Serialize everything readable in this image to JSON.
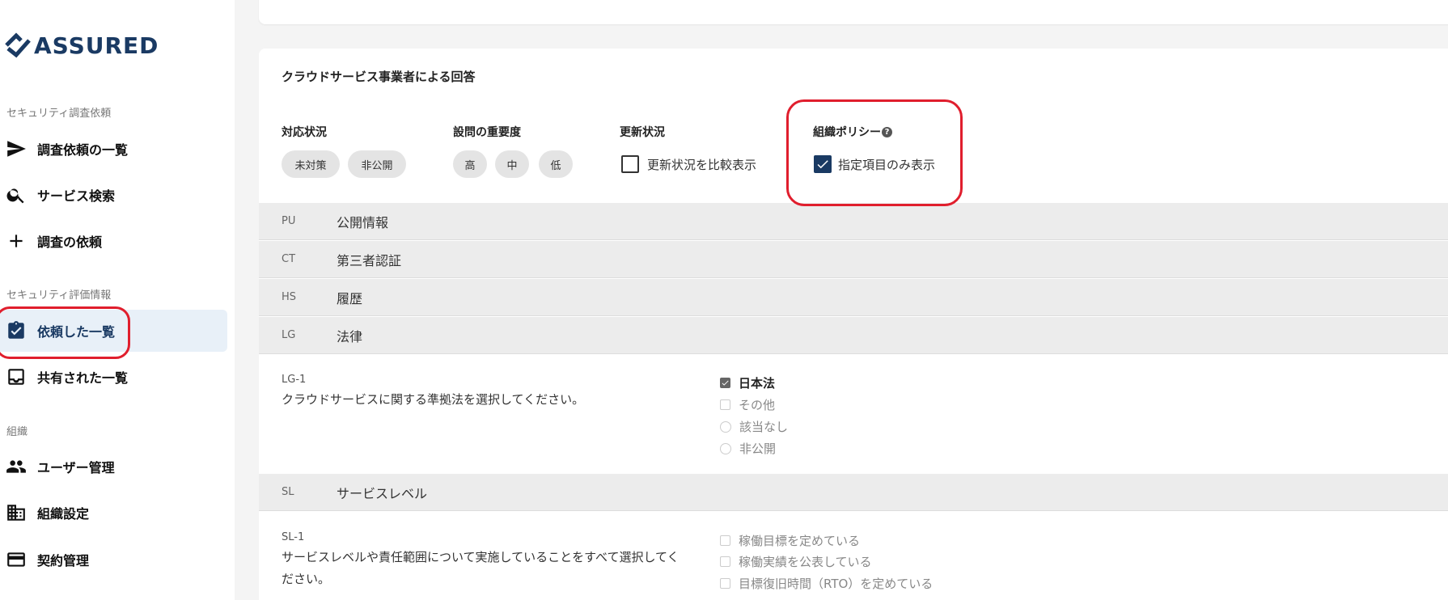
{
  "brand": {
    "name": "ASSURED",
    "color": "#1a3a63"
  },
  "sidebar": {
    "sections": [
      {
        "label": "セキュリティ調査依頼"
      },
      {
        "label": "セキュリティ評価情報"
      },
      {
        "label": "組織"
      }
    ],
    "items": [
      {
        "label": "調査依頼の一覧",
        "icon": "send-icon"
      },
      {
        "label": "サービス検索",
        "icon": "search-icon"
      },
      {
        "label": "調査の依頼",
        "icon": "plus-icon"
      },
      {
        "label": "依頼した一覧",
        "icon": "clipboard-check-icon",
        "active": true
      },
      {
        "label": "共有された一覧",
        "icon": "inbox-icon"
      },
      {
        "label": "ユーザー管理",
        "icon": "people-icon"
      },
      {
        "label": "組織設定",
        "icon": "building-icon"
      },
      {
        "label": "契約管理",
        "icon": "credit-card-icon"
      }
    ]
  },
  "panel": {
    "title": "クラウドサービス事業者による回答",
    "filters": {
      "status": {
        "label": "対応状況",
        "chips": [
          "未対策",
          "非公開"
        ]
      },
      "importance": {
        "label": "設問の重要度",
        "chips": [
          "高",
          "中",
          "低"
        ]
      },
      "update": {
        "label": "更新状況",
        "checkbox_label": "更新状況を比較表示",
        "checked": false
      },
      "policy": {
        "label": "組織ポリシー",
        "help": "?",
        "checkbox_label": "指定項目のみ表示",
        "checked": true
      }
    },
    "categories": [
      {
        "code": "PU",
        "name": "公開情報"
      },
      {
        "code": "CT",
        "name": "第三者認証"
      },
      {
        "code": "HS",
        "name": "履歴"
      },
      {
        "code": "LG",
        "name": "法律"
      },
      {
        "code": "SL",
        "name": "サービスレベル"
      }
    ],
    "questions": [
      {
        "code": "LG-1",
        "text": "クラウドサービスに関する準拠法を選択してください。",
        "options": [
          {
            "label": "日本法",
            "type": "checkbox",
            "selected": true
          },
          {
            "label": "その他",
            "type": "checkbox",
            "selected": false
          },
          {
            "label": "該当なし",
            "type": "radio",
            "selected": false
          },
          {
            "label": "非公開",
            "type": "radio",
            "selected": false
          }
        ]
      },
      {
        "code": "SL-1",
        "text": "サービスレベルや責任範囲について実施していることをすべて選択してください。",
        "options": [
          {
            "label": "稼働目標を定めている",
            "type": "checkbox",
            "selected": false
          },
          {
            "label": "稼働実績を公表している",
            "type": "checkbox",
            "selected": false
          },
          {
            "label": "目標復旧時間（RTO）を定めている",
            "type": "checkbox",
            "selected": false
          }
        ]
      }
    ]
  },
  "colors": {
    "highlight": "#e01e2d",
    "active_bg": "#e8f0f8",
    "category_bg": "#ececec"
  }
}
